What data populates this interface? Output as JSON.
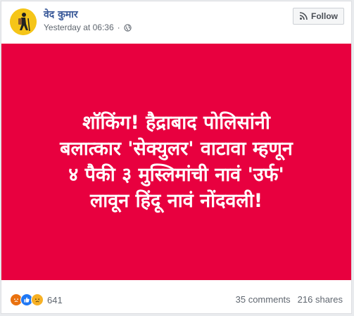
{
  "post": {
    "author": "वेद कुमार",
    "timestamp": "Yesterday at 06:36",
    "privacy_icon": "globe-icon",
    "follow_label": "Follow",
    "image": {
      "background_color": "#e8003f",
      "lines": [
        "शॉकिंग! हैद्राबाद पोलिसांनी",
        "बलात्कार 'सेक्युलर' वाटावा म्हणून",
        "४ पैकी ३ मुस्लिमांची नावं 'उर्फ'",
        "लावून हिंदू नावं नोंदवली!"
      ]
    },
    "reactions": {
      "icons": [
        "angry-icon",
        "like-icon",
        "sad-icon"
      ],
      "count": "641"
    },
    "comments": "35 comments",
    "shares": "216 shares"
  }
}
